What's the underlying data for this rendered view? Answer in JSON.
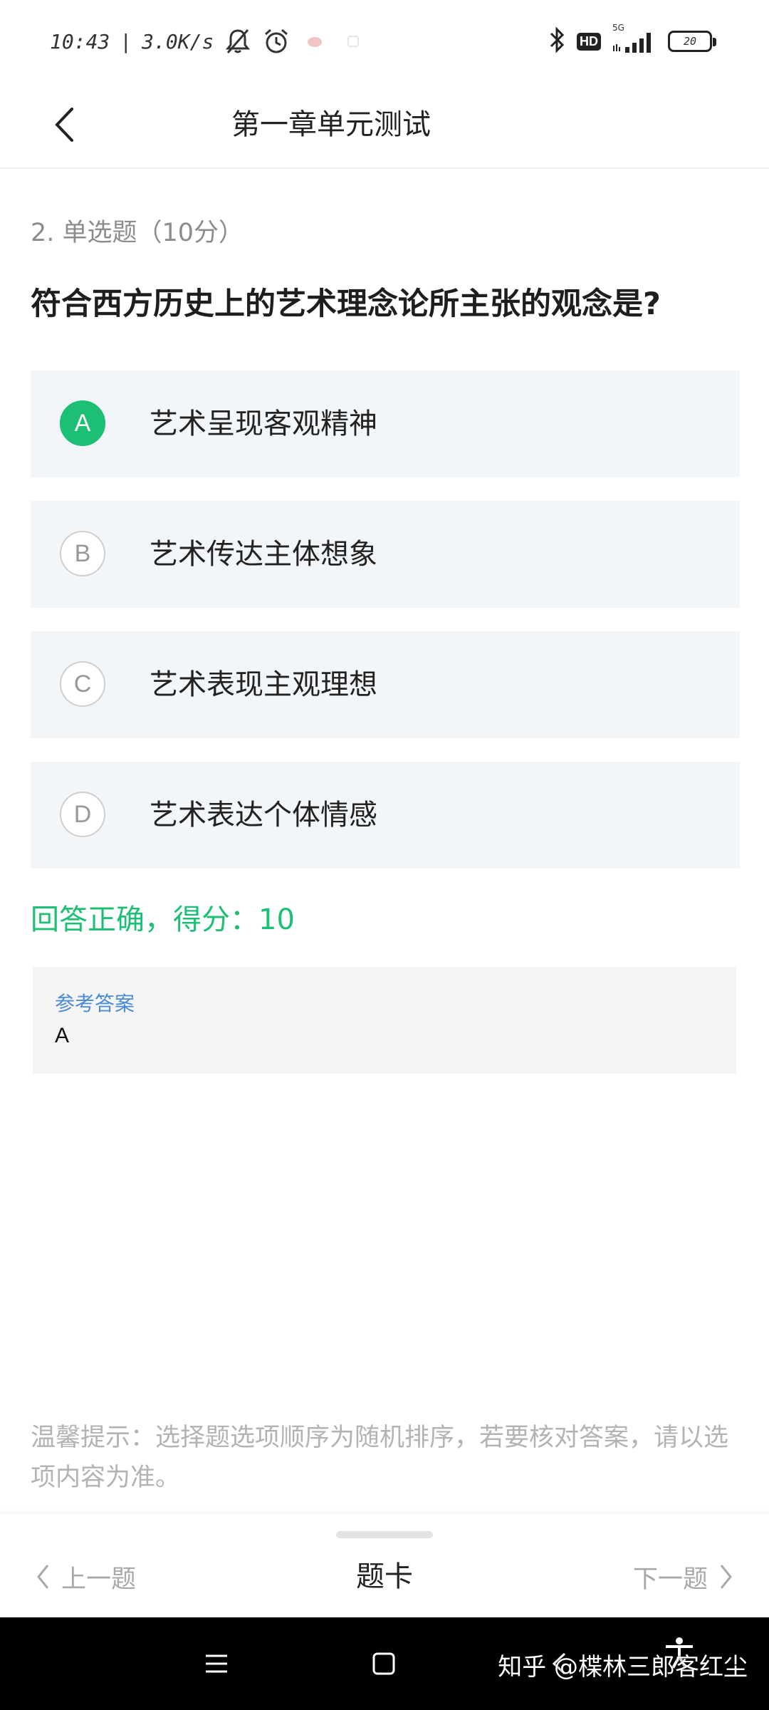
{
  "status_bar": {
    "time": "10:43",
    "separator": "|",
    "net_speed": "3.0K/s",
    "signal_label": "5G",
    "hd_label": "HD",
    "battery": "20",
    "icons": [
      "mute-bell-icon",
      "alarm-icon",
      "app-notification-icon",
      "app-notification-icon-2",
      "bluetooth-icon",
      "signal-icon",
      "battery-icon"
    ]
  },
  "header": {
    "title": "第一章单元测试",
    "back_icon": "chevron-left-icon"
  },
  "question": {
    "meta": "2. 单选题（10分）",
    "text": "符合西方历史上的艺术理念论所主张的观念是?"
  },
  "options": [
    {
      "letter": "A",
      "text": "艺术呈现客观精神",
      "selected": true
    },
    {
      "letter": "B",
      "text": "艺术传达主体想象",
      "selected": false
    },
    {
      "letter": "C",
      "text": "艺术表现主观理想",
      "selected": false
    },
    {
      "letter": "D",
      "text": "艺术表达个体情感",
      "selected": false
    }
  ],
  "result": "回答正确，得分：10",
  "reference": {
    "label": "参考答案",
    "value": "A"
  },
  "tip": "温馨提示：选择题选项顺序为随机排序，若要核对答案，请以选项内容为准。",
  "bottom_nav": {
    "prev": "上一题",
    "card": "题卡",
    "next": "下一题"
  },
  "watermark": "知乎 @楪林三郎客红尘",
  "colors": {
    "accent_green": "#1dbf74",
    "option_bg": "#f3f6f9",
    "reference_label": "#4a8ad6"
  }
}
